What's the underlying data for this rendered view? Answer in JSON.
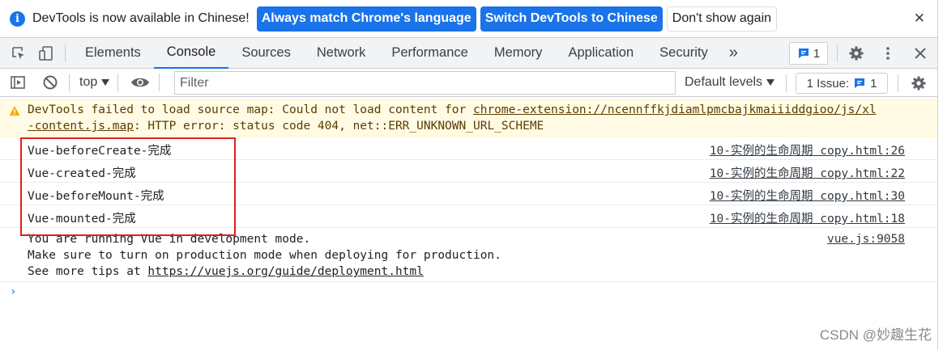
{
  "infobar": {
    "message": "DevTools is now available in Chinese!",
    "btn_match": "Always match Chrome's language",
    "btn_switch": "Switch DevTools to Chinese",
    "btn_dismiss": "Don't show again",
    "close_glyph": "✕"
  },
  "tabs": [
    {
      "label": "Elements"
    },
    {
      "label": "Console"
    },
    {
      "label": "Sources"
    },
    {
      "label": "Network"
    },
    {
      "label": "Performance"
    },
    {
      "label": "Memory"
    },
    {
      "label": "Application"
    },
    {
      "label": "Security"
    }
  ],
  "tabbar": {
    "more_glyph": "»",
    "issue_count": "1"
  },
  "console_toolbar": {
    "context": "top",
    "filter_placeholder": "Filter",
    "levels": "Default levels",
    "issues_label": "1 Issue:",
    "issues_count": "1"
  },
  "warning": {
    "line1_prefix": "DevTools failed to load source map: Could not load content for ",
    "line1_link": "chrome-extension://ncennffkjdiamlpmcbajkmaiiiddgioo/js/xl",
    "line2_link": "-content.js.map",
    "line2_suffix": ": HTTP error: status code 404, net::ERR_UNKNOWN_URL_SCHEME"
  },
  "logs": [
    {
      "message": "Vue-beforeCreate-完成",
      "source": "10-实例的生命周期 copy.html:26"
    },
    {
      "message": "Vue-created-完成",
      "source": "10-实例的生命周期 copy.html:22"
    },
    {
      "message": "Vue-beforeMount-完成",
      "source": "10-实例的生命周期 copy.html:30"
    },
    {
      "message": "Vue-mounted-完成",
      "source": "10-实例的生命周期 copy.html:18"
    }
  ],
  "vue_notice": {
    "line1": "You are running Vue in development mode.",
    "line2": "Make sure to turn on production mode when deploying for production.",
    "line3_prefix": "See more tips at ",
    "line3_link": "https://vuejs.org/guide/deployment.html",
    "source": "vue.js:9058"
  },
  "prompt_glyph": "›",
  "watermark": "CSDN @妙趣生花",
  "colors": {
    "accent": "#1a73e8",
    "warning_bg": "#fffbe5",
    "warning_text": "#5c3c00",
    "highlight_box": "#e02020"
  }
}
